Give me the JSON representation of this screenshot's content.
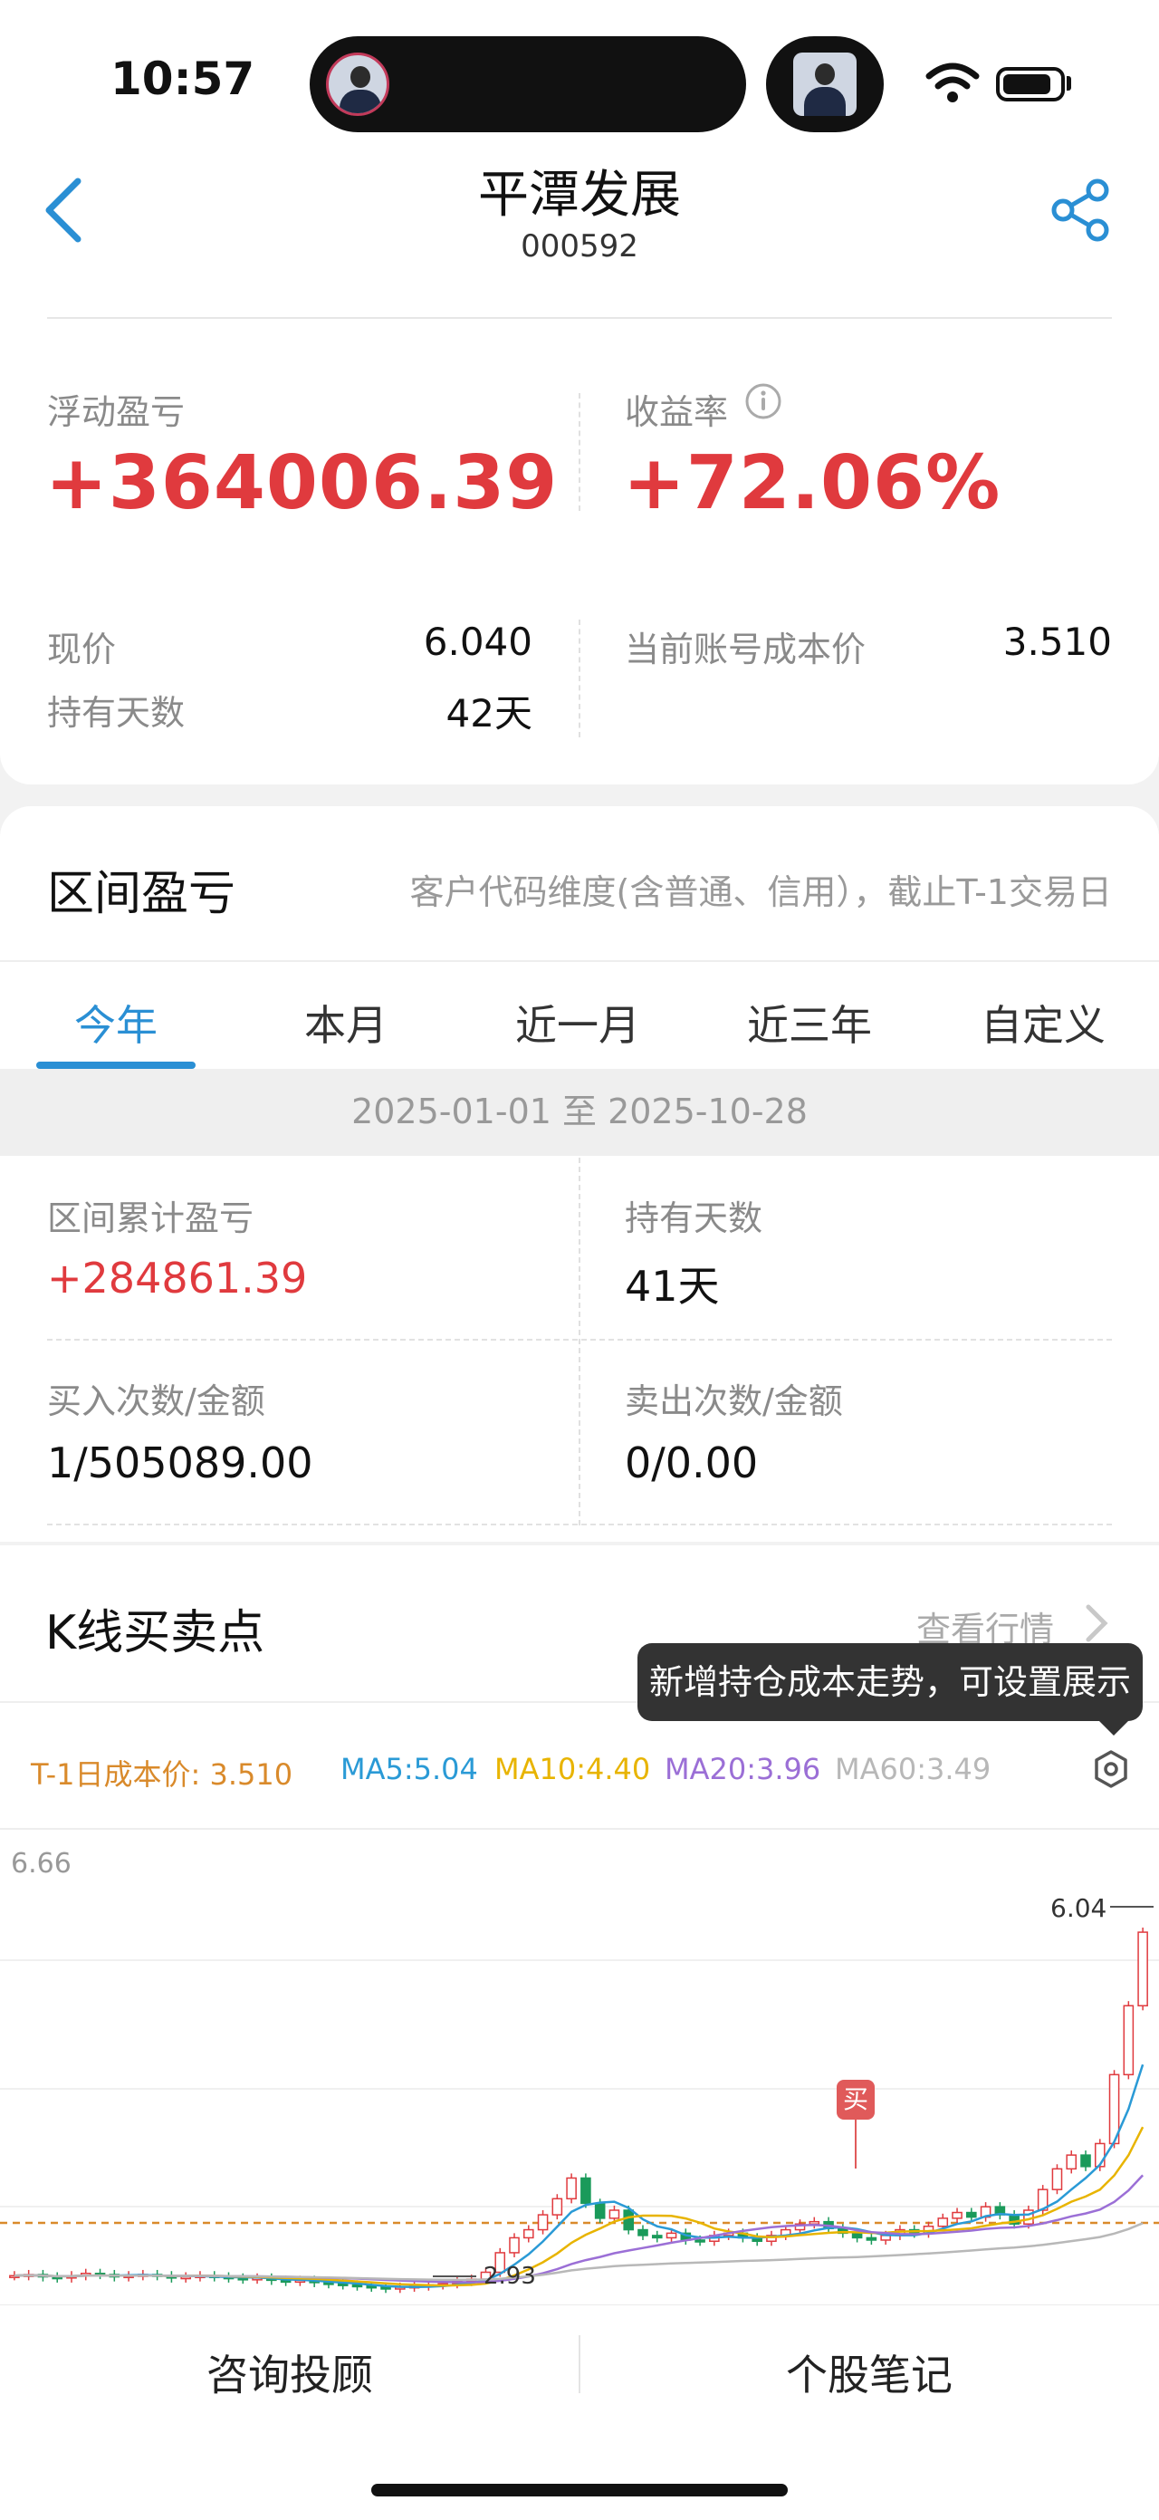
{
  "status": {
    "time": "10:57"
  },
  "header": {
    "title": "平潭发展",
    "code": "000592"
  },
  "summary": {
    "float_pl_label": "浮动盈亏",
    "float_pl_value": "+364006.39",
    "return_label": "收益率",
    "return_value": "+72.06%",
    "price_label": "现价",
    "price_value": "6.040",
    "days_label": "持有天数",
    "days_value": "42天",
    "cost_label": "当前账号成本价",
    "cost_value": "3.510"
  },
  "range": {
    "title": "区间盈亏",
    "subtitle": "客户代码维度(含普通、信用），截止T-1交易日",
    "tabs": [
      "今年",
      "本月",
      "近一月",
      "近三年",
      "自定义"
    ],
    "date_range": "2025-01-01 至 2025-10-28",
    "cum_pl_label": "区间累计盈亏",
    "cum_pl_value": "+284861.39",
    "hold_days_label": "持有天数",
    "hold_days_value": "41天",
    "buy_label": "买入次数/金额",
    "buy_value": "1/505089.00",
    "sell_label": "卖出次数/金额",
    "sell_value": "0/0.00"
  },
  "kline": {
    "title": "K线买卖点",
    "view_quotes": "查看行情",
    "tooltip": "新增持仓成本走势，可设置展示",
    "cost_legend": "T-1日成本价: 3.510",
    "ma5": "MA5:5.04",
    "ma10": "MA10:4.40",
    "ma20": "MA20:3.96",
    "ma60": "MA60:3.49",
    "y_top": "6.66",
    "last_price": "6.04",
    "low_label": "2.93",
    "buy_marker": "买",
    "colors": {
      "cost": "#d98a2b",
      "ma5": "#2a9ad6",
      "ma10": "#e8b400",
      "ma20": "#9b6fd6",
      "ma60": "#b8b8b8",
      "up": "#e03a3e",
      "down": "#1a9a5a"
    }
  },
  "bottom": {
    "advisor": "咨询投顾",
    "notes": "个股笔记"
  },
  "chart_data": {
    "type": "candlestick",
    "y_axis_top": 6.66,
    "last_close": 6.04,
    "period_low": 2.93,
    "cost_price": 3.51,
    "buy_marker_price": 3.51,
    "ma_latest": {
      "MA5": 5.04,
      "MA10": 4.4,
      "MA20": 3.96,
      "MA60": 3.49
    },
    "closes": [
      3.05,
      3.06,
      3.04,
      3.03,
      3.05,
      3.07,
      3.06,
      3.04,
      3.05,
      3.06,
      3.05,
      3.03,
      3.04,
      3.05,
      3.04,
      3.03,
      3.02,
      3.03,
      3.01,
      3.0,
      3.01,
      2.99,
      2.98,
      2.97,
      2.96,
      2.95,
      2.94,
      2.95,
      2.96,
      2.97,
      2.98,
      3.0,
      3.02,
      3.08,
      3.25,
      3.38,
      3.45,
      3.58,
      3.72,
      3.9,
      3.68,
      3.55,
      3.62,
      3.45,
      3.4,
      3.38,
      3.42,
      3.36,
      3.35,
      3.4,
      3.42,
      3.38,
      3.35,
      3.4,
      3.45,
      3.5,
      3.52,
      3.46,
      3.42,
      3.38,
      3.36,
      3.4,
      3.45,
      3.42,
      3.48,
      3.55,
      3.6,
      3.56,
      3.65,
      3.58,
      3.5,
      3.62,
      3.8,
      3.98,
      4.1,
      4.0,
      4.2,
      4.8,
      5.4,
      6.04
    ]
  }
}
